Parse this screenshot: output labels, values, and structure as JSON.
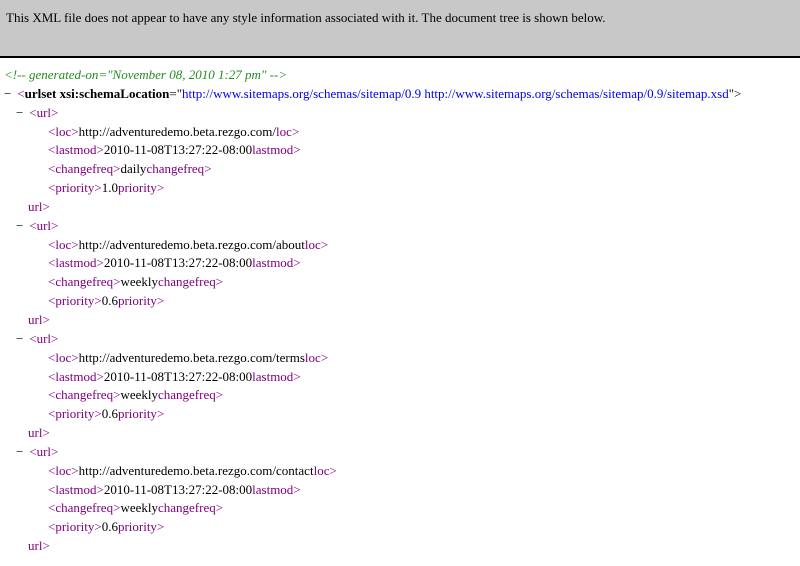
{
  "banner": "This XML file does not appear to have any style information associated with it. The document tree is shown below.",
  "comment": "<!-- generated-on=\"November 08, 2010 1:27 pm\" -->",
  "toggle": "−",
  "urlset": {
    "openPrefix": "<",
    "name": "urlset",
    "attrName": " xsi:schemaLocation",
    "eq": "=\"",
    "attrVal": "http://www.sitemaps.org/schemas/sitemap/0.9 http://www.sitemaps.org/schemas/sitemap/0.9/sitemap.xsd",
    "closeQ": "\">"
  },
  "lt": "<",
  "gt": ">",
  "cl": "</",
  "tags": {
    "url": "url",
    "loc": "loc",
    "lastmod": "lastmod",
    "changefreq": "changefreq",
    "priority": "priority"
  },
  "entries": [
    {
      "loc": "http://adventuredemo.beta.rezgo.com/",
      "lastmod": "2010-11-08T13:27:22-08:00",
      "changefreq": "daily",
      "priority": "1.0"
    },
    {
      "loc": "http://adventuredemo.beta.rezgo.com/about",
      "lastmod": "2010-11-08T13:27:22-08:00",
      "changefreq": "weekly",
      "priority": "0.6"
    },
    {
      "loc": "http://adventuredemo.beta.rezgo.com/terms",
      "lastmod": "2010-11-08T13:27:22-08:00",
      "changefreq": "weekly",
      "priority": "0.6"
    },
    {
      "loc": "http://adventuredemo.beta.rezgo.com/contact",
      "lastmod": "2010-11-08T13:27:22-08:00",
      "changefreq": "weekly",
      "priority": "0.6"
    }
  ]
}
